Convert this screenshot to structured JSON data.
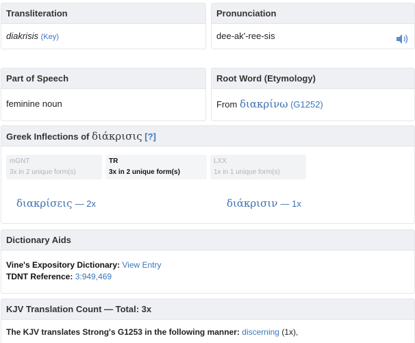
{
  "transliteration": {
    "header": "Transliteration",
    "value": "diakrisis",
    "key_link": "(Key)"
  },
  "pronunciation": {
    "header": "Pronunciation",
    "value": "dee-ak'-ree-sis",
    "icon": "speaker-icon"
  },
  "part_of_speech": {
    "header": "Part of Speech",
    "value": "feminine noun"
  },
  "root_word": {
    "header": "Root Word (Etymology)",
    "prefix": "From",
    "greek": "διακρίνω",
    "strongs": "(G1252)"
  },
  "inflections": {
    "header_prefix": "Greek Inflections of",
    "header_word": "διάκρισις",
    "help_link": "[?]",
    "tabs": [
      {
        "name": "mGNT",
        "count": "3x in 2 unique form(s)"
      },
      {
        "name": "TR",
        "count": "3x in 2 unique form(s)"
      },
      {
        "name": "LXX",
        "count": "1x in 1 unique form(s)"
      }
    ],
    "forms": [
      {
        "word": "διακρίσεις",
        "count": "— 2x"
      },
      {
        "word": "διάκρισιν",
        "count": "— 1x"
      }
    ]
  },
  "dictionary_aids": {
    "header": "Dictionary Aids",
    "vines_label": "Vine's Expository Dictionary:",
    "vines_link": "View Entry",
    "tdnt_label": "TDNT Reference:",
    "tdnt_link": "3:949,469"
  },
  "kjv": {
    "header": "KJV Translation Count — Total: 3x",
    "text": "The KJV translates Strong's G1253 in the following manner:",
    "link": "discerning",
    "suffix": "(1x),"
  }
}
